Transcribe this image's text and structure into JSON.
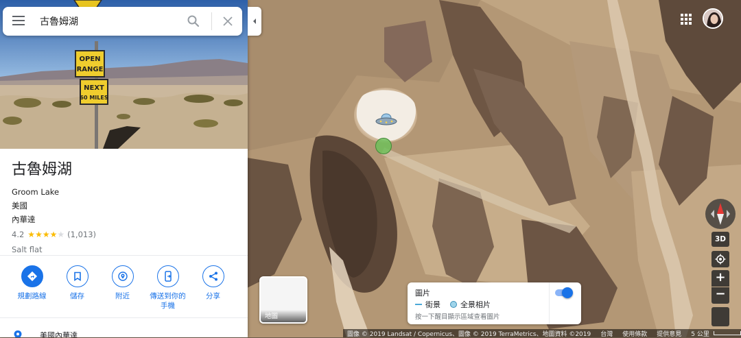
{
  "search": {
    "value": "古魯姆湖"
  },
  "place": {
    "name": "古魯姆湖",
    "name_en": "Groom Lake",
    "country": "美國",
    "region": "內華達",
    "rating": "4.2",
    "stars": {
      "filled": 4,
      "total": 5
    },
    "review_count": "(1,013)",
    "category": "Salt flat",
    "address_preview": "美國內華達"
  },
  "hero_sign": {
    "line1": "OPEN",
    "line2": "RANGE",
    "line3": "NEXT",
    "line4": "60 MILES"
  },
  "actions": [
    {
      "label": "規劃路線",
      "icon": "directions-icon"
    },
    {
      "label": "儲存",
      "icon": "bookmark-icon"
    },
    {
      "label": "附近",
      "icon": "nearby-icon"
    },
    {
      "label": "傳送到你的",
      "label2": "手機",
      "icon": "send-to-phone-icon"
    },
    {
      "label": "分享",
      "icon": "share-icon"
    }
  ],
  "map_controls": {
    "btn_3d": "3D",
    "zoom_in": "+",
    "zoom_out": "−"
  },
  "layer_thumb": {
    "label": "地圖"
  },
  "photo_card": {
    "title": "圖片",
    "legend_street": "街景",
    "legend_pano": "全景相片",
    "hint": "按一下醒目顯示區域查看圖片",
    "toggle_on": true
  },
  "footer": {
    "attribution": "圖像 © 2019 Landsat / Copernicus、圖像 © 2019 TerraMetrics、地圖資料 ©2019",
    "region": "台灣",
    "terms": "使用條款",
    "feedback": "提供意見",
    "scale": "5 公里"
  },
  "colors": {
    "accent": "#1a73e8",
    "star": "#fbbc04",
    "map_terrain": "#b89c7a"
  }
}
